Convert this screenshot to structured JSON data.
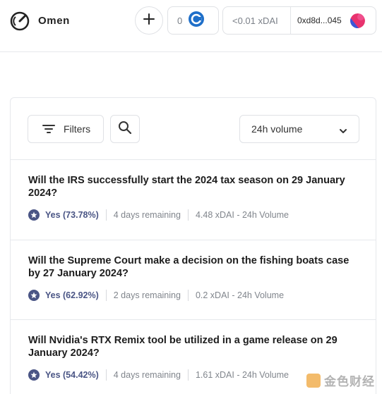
{
  "header": {
    "brand": "Omen",
    "count": "0",
    "balance": "<0.01 xDAI",
    "address": "0xd8d...045"
  },
  "toolbar": {
    "filters_label": "Filters",
    "sort_value": "24h volume"
  },
  "markets": [
    {
      "title": "Will the IRS successfully start the 2024 tax season on 29 January 2024?",
      "outcome": "Yes (73.78%)",
      "remaining": "4 days remaining",
      "volume": "4.48 xDAI - 24h Volume"
    },
    {
      "title": "Will the Supreme Court make a decision on the fishing boats case by 27 January 2024?",
      "outcome": "Yes (62.92%)",
      "remaining": "2 days remaining",
      "volume": "0.2 xDAI - 24h Volume"
    },
    {
      "title": "Will Nvidia's RTX Remix tool be utilized in a game release on 29 January 2024?",
      "outcome": "Yes (54.42%)",
      "remaining": "4 days remaining",
      "volume": "1.61 xDAI - 24h Volume"
    }
  ],
  "watermark": {
    "text": "金色财经"
  },
  "colors": {
    "accent": "#4a5585",
    "count_icon": "#1f6fc9",
    "watermark": "#f0a53a"
  },
  "icons": [
    "omen-logo-icon",
    "plus-icon",
    "count-icon",
    "wallet-avatar-icon",
    "filter-icon",
    "search-icon",
    "chevron-down-icon",
    "star-icon"
  ]
}
